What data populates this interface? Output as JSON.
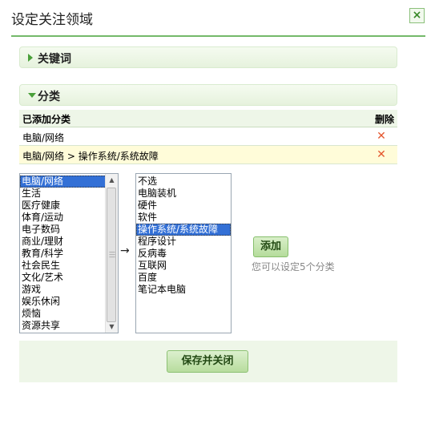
{
  "dialog": {
    "title": "设定关注领域",
    "close_label": "×"
  },
  "sections": {
    "keywords_label": "关键词",
    "categories_label": "分类"
  },
  "table": {
    "header_added": "已添加分类",
    "header_delete": "删除",
    "rows": [
      {
        "label": "电脑/网络"
      },
      {
        "label": "电脑/网络 > 操作系统/系统故障"
      }
    ]
  },
  "left_list": {
    "items": [
      "电脑/网络",
      "生活",
      "医疗健康",
      "体育/运动",
      "电子数码",
      "商业/理财",
      "教育/科学",
      "社会民生",
      "文化/艺术",
      "游戏",
      "娱乐休闲",
      "烦恼",
      "资源共享"
    ],
    "selected": "电脑/网络"
  },
  "right_list": {
    "items": [
      "不选",
      "电脑装机",
      "硬件",
      "软件",
      "操作系统/系统故障",
      "程序设计",
      "反病毒",
      "互联网",
      "百度",
      "笔记本电脑"
    ],
    "selected": "操作系统/系统故障"
  },
  "arrow_glyph": "→",
  "add_button": "添加",
  "hint": "您可以设定5个分类",
  "save_button": "保存并关闭"
}
